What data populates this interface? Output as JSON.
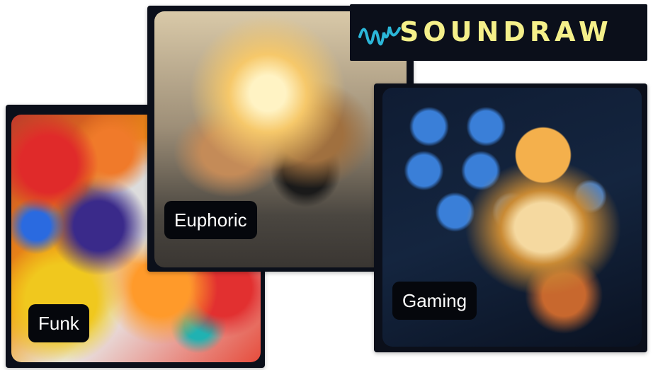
{
  "logo": {
    "text": "SOUNDRAW",
    "text_color": "#f5f08a",
    "mark_color": "#2bb6d8",
    "background": "#0b0f1a"
  },
  "cards": [
    {
      "id": "funk",
      "label": "Funk"
    },
    {
      "id": "euphoric",
      "label": "Euphoric"
    },
    {
      "id": "gaming",
      "label": "Gaming"
    }
  ]
}
